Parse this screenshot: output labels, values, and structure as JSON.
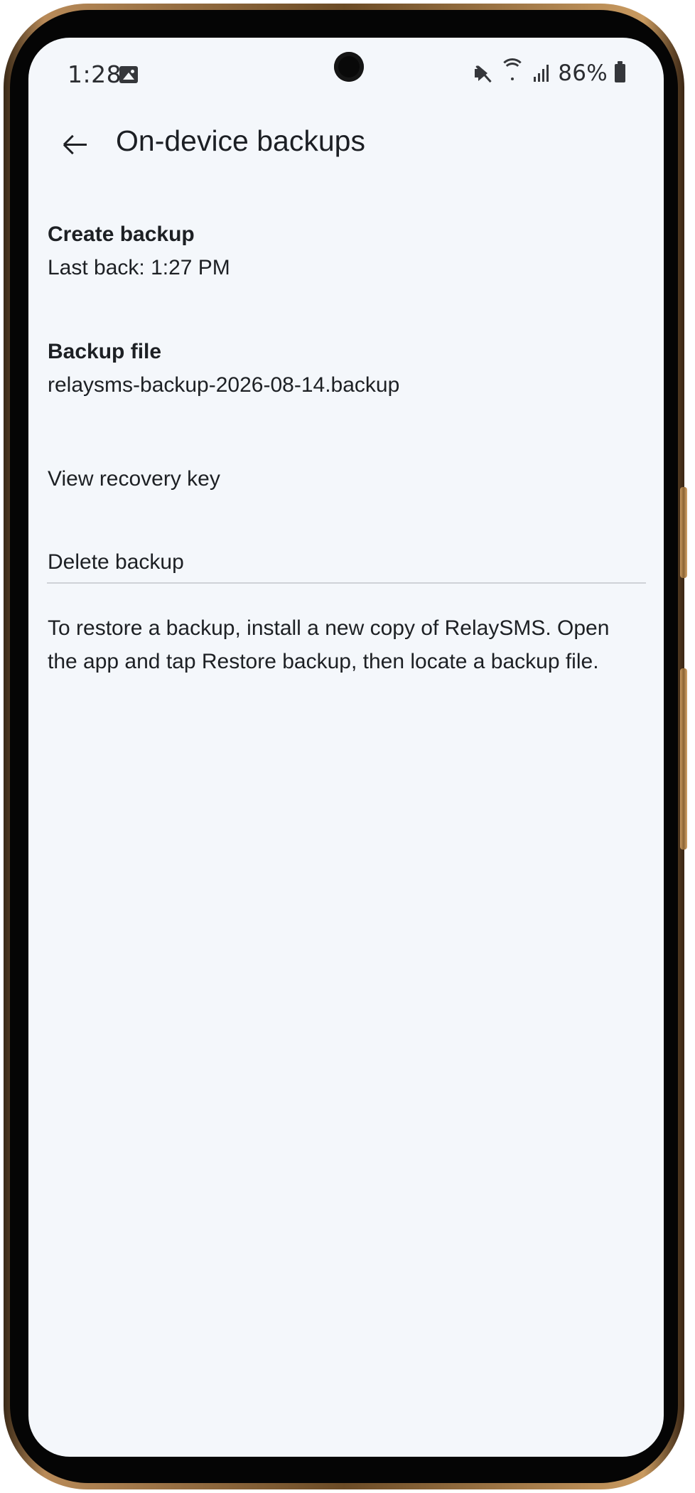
{
  "status_bar": {
    "time": "1:28",
    "battery_percent": "86%",
    "icons": {
      "gallery": "image-icon",
      "mute": "mute-icon",
      "wifi": "wifi-icon",
      "signal": "signal-icon",
      "battery": "battery-icon"
    }
  },
  "app_bar": {
    "title": "On-device backups",
    "back_icon": "back-arrow-icon"
  },
  "settings": {
    "create_backup": {
      "title": "Create backup",
      "subtitle": "Last back: 1:27 PM"
    },
    "backup_file": {
      "title": "Backup file",
      "subtitle": "relaysms-backup-2026-08-14.backup"
    },
    "view_recovery_key": {
      "label": "View recovery key"
    },
    "delete_backup": {
      "label": "Delete backup"
    }
  },
  "restore_note": "To restore a backup, install a new copy of RelaySMS. Open the app and tap Restore backup, then locate a backup file.",
  "colors": {
    "background": "#f4f7fb",
    "text": "#1d2024",
    "divider": "#cfd2d7",
    "device_frame": "#050505",
    "gold_trim": "#b88a58"
  }
}
